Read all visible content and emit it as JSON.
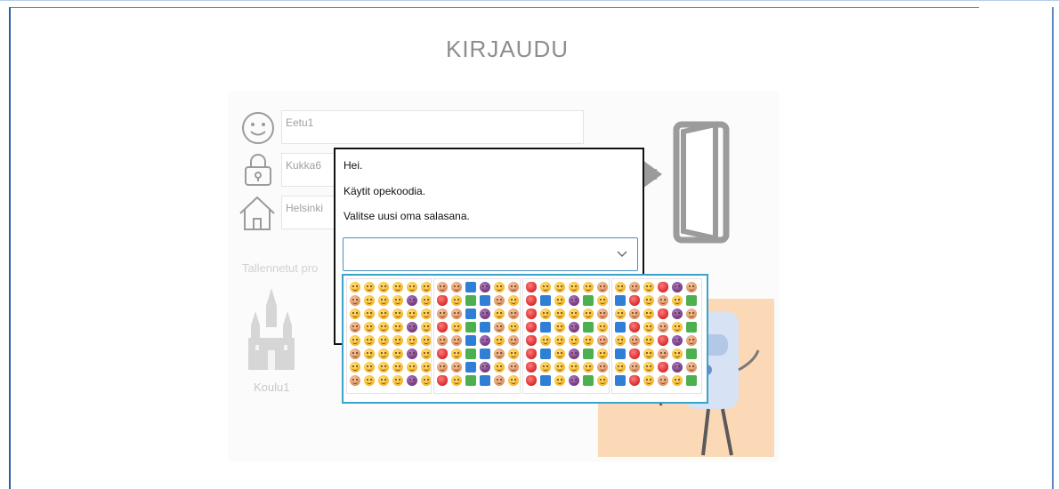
{
  "page": {
    "title": "KIRJAUDU"
  },
  "form": {
    "username_value": "Eetu1",
    "password_value": "Kukka6",
    "city_value": "Helsinki",
    "saved_profiles_label": "Tallennetut pro",
    "school_label": "Koulu1"
  },
  "dialog": {
    "greeting": "Hei.",
    "line2": "Käytit opekoodia.",
    "line3": "Valitse uusi oma salasana.",
    "select_value": ""
  },
  "emoji_picker": {
    "panels": [
      {
        "name": "faces",
        "count": 48
      },
      {
        "name": "people-objects",
        "count": 48
      },
      {
        "name": "symbols-hearts",
        "count": 48
      },
      {
        "name": "gestures-misc",
        "count": 48
      }
    ]
  },
  "icons": [
    "smiley-icon",
    "lock-icon",
    "house-icon",
    "door-icon",
    "castle-icon",
    "chevron-down-icon"
  ]
}
